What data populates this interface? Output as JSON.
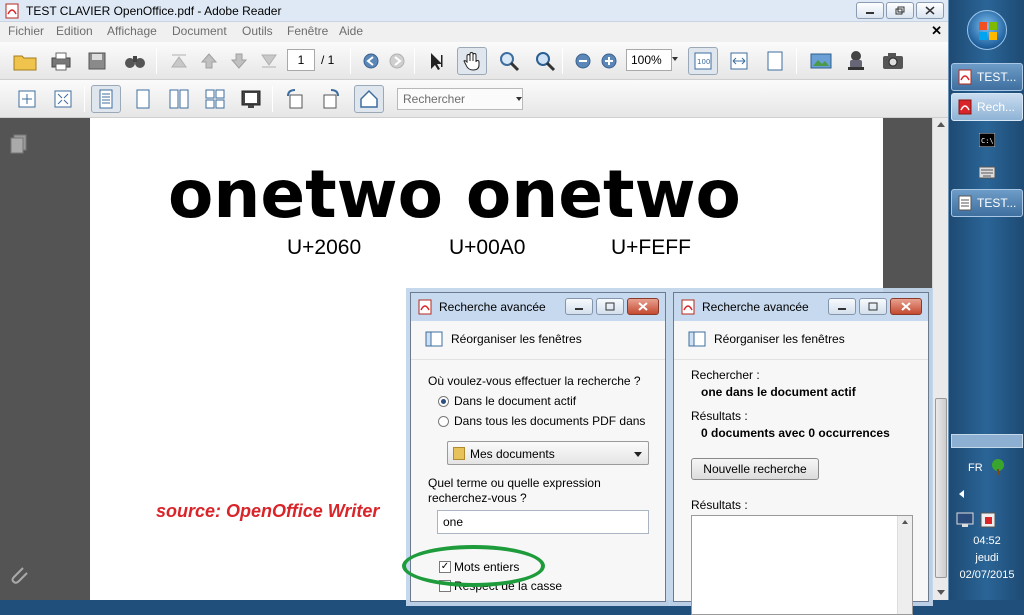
{
  "window": {
    "title": "TEST CLAVIER OpenOffice.pdf - Adobe Reader"
  },
  "menu": [
    "Fichier",
    "Edition",
    "Affichage",
    "Document",
    "Outils",
    "Fenêtre",
    "Aide"
  ],
  "toolbar": {
    "page_current": "1",
    "page_total": "/ 1",
    "zoom": "100%",
    "search_placeholder": "Rechercher"
  },
  "document": {
    "big_text": "onetwo onetwo",
    "codes": [
      "U+2060",
      "U+00A0",
      "U+FEFF"
    ],
    "source": "source: OpenOffice Writer"
  },
  "dialog_left": {
    "title": "Recherche avancée",
    "reorganize": "Réorganiser les fenêtres",
    "where_question": "Où voulez-vous effectuer la recherche ?",
    "option_active": "Dans le document actif",
    "option_all": "Dans tous les documents PDF dans",
    "location": "Mes documents",
    "term_question_1": "Quel terme ou quelle expression",
    "term_question_2": "recherchez-vous ?",
    "term_value": "one",
    "whole_words": "Mots entiers",
    "case_sensitive": "Respect de la casse"
  },
  "dialog_right": {
    "title": "Recherche avancée",
    "reorganize": "Réorganiser les fenêtres",
    "search_label": "Rechercher :",
    "search_value": "one dans le document actif",
    "results_label": "Résultats :",
    "results_value": "0 documents avec 0 occurrences",
    "new_search": "Nouvelle recherche",
    "results_label_2": "Résultats :"
  },
  "taskbar": {
    "items": [
      "TEST...",
      "Rech...",
      "TEST..."
    ],
    "language": "FR",
    "time": "04:52",
    "day": "jeudi",
    "date": "02/07/2015"
  },
  "colors": {
    "accent_red": "#d9252a",
    "highlight_green": "#1e9b3b"
  }
}
